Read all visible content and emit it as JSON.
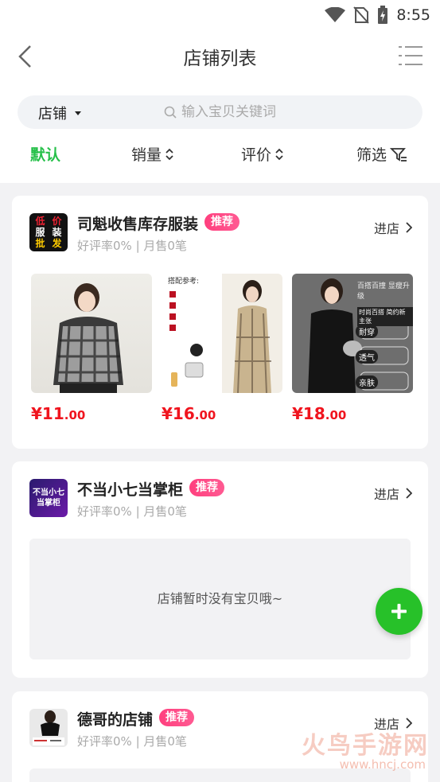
{
  "status_bar": {
    "time": "8:55"
  },
  "header": {
    "title": "店铺列表"
  },
  "search": {
    "type_label": "店铺",
    "placeholder": "输入宝贝关键词"
  },
  "sort_tabs": [
    {
      "label": "默认",
      "active": true
    },
    {
      "label": "销量",
      "active": false
    },
    {
      "label": "评价",
      "active": false
    },
    {
      "label": "筛选",
      "active": false
    }
  ],
  "shops": [
    {
      "name": "司魁收售库存服装",
      "badge": "推荐",
      "stats": "好评率0% | 月售0笔",
      "enter_label": "进店",
      "logo_text": [
        "低",
        "价",
        "服",
        "装",
        "批",
        "发"
      ],
      "products": [
        {
          "price_symbol": "¥",
          "price_int": "11",
          "price_dec": ".00"
        },
        {
          "price_symbol": "¥",
          "price_int": "16",
          "price_dec": ".00",
          "img_text": [
            "搭配参考:"
          ]
        },
        {
          "price_symbol": "¥",
          "price_int": "18",
          "price_dec": ".00",
          "img_text": [
            "百搭百撞 显瘦升级",
            "时尚百搭 简约新主张",
            "耐穿",
            "透气",
            "亲肤"
          ]
        }
      ]
    },
    {
      "name": "不当小七当掌柜",
      "badge": "推荐",
      "stats": "好评率0% | 月售0笔",
      "enter_label": "进店",
      "logo_text": [
        "不当小七",
        "当掌柜"
      ],
      "empty_text": "店铺暂时没有宝贝哦~"
    },
    {
      "name": "德哥的店铺",
      "badge": "推荐",
      "stats": "好评率0% | 月售0笔",
      "enter_label": "进店"
    }
  ],
  "watermark": {
    "text": "火鸟手游网",
    "url": "www.hncj.com"
  },
  "colors": {
    "accent": "#27c04a",
    "price": "#f0141e",
    "badge": "#ff3f7e",
    "fab": "#27c129"
  }
}
